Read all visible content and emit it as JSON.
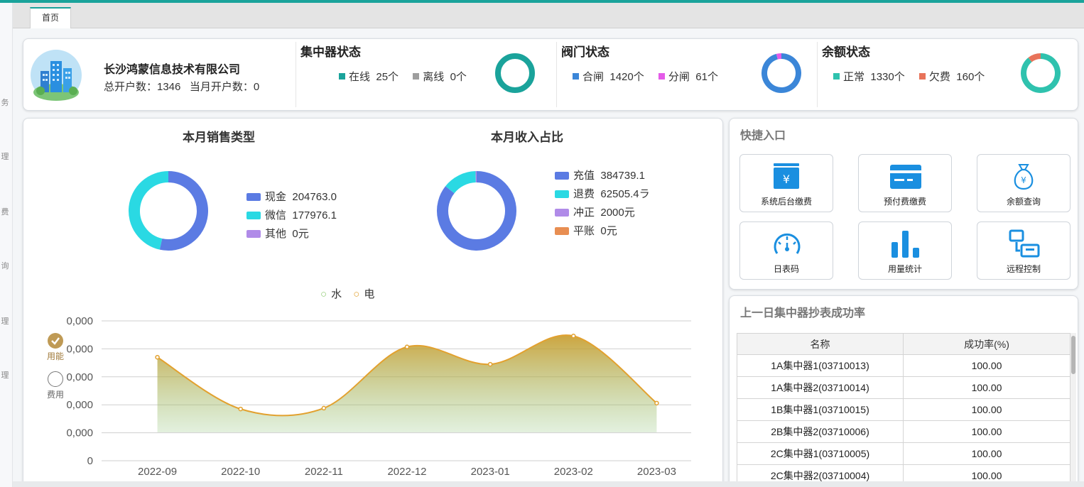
{
  "tabs": [
    {
      "label": "首页"
    }
  ],
  "sidebar_fragments": [
    "务",
    "理",
    "费",
    "询",
    "理",
    "理"
  ],
  "company": {
    "name": "长沙鸿蒙信息技术有限公司",
    "counts_text": "总开户数：1346   当月开户数：0"
  },
  "concentrator": {
    "title": "集中器状态",
    "items": [
      {
        "label": "在线",
        "value": "25个",
        "color": "#1aa39b",
        "count": 25
      },
      {
        "label": "离线",
        "value": "0个",
        "color": "#9e9e9e",
        "count": 0
      }
    ]
  },
  "valve": {
    "title": "阀门状态",
    "items": [
      {
        "label": "合闸",
        "value": "1420个",
        "color": "#3b86d8",
        "count": 1420
      },
      {
        "label": "分闸",
        "value": "61个",
        "color": "#e45be8",
        "count": 61
      }
    ]
  },
  "balance": {
    "title": "余额状态",
    "items": [
      {
        "label": "正常",
        "value": "1330个",
        "color": "#2fc2ae",
        "count": 1330
      },
      {
        "label": "欠费",
        "value": "160个",
        "color": "#e8735a",
        "count": 160
      }
    ]
  },
  "sales_pie": {
    "title": "本月销售类型",
    "items": [
      {
        "label": "现金",
        "value": "204763.0",
        "color": "#5b7be3",
        "amount": 204763.0
      },
      {
        "label": "微信",
        "value": "177976.1",
        "color": "#2ad9e3",
        "amount": 177976.1
      },
      {
        "label": "其他",
        "value": "0元",
        "color": "#b08be8",
        "amount": 0
      }
    ]
  },
  "income_pie": {
    "title": "本月收入占比",
    "items": [
      {
        "label": "充值",
        "value": "384739.1",
        "color": "#5b7be3",
        "amount": 384739.1
      },
      {
        "label": "退费",
        "value": "62505.4ラ",
        "color": "#2ad9e3",
        "amount": 62505.4
      },
      {
        "label": "冲正",
        "value": "2000元",
        "color": "#b08be8",
        "amount": 2000
      },
      {
        "label": "平账",
        "value": "0元",
        "color": "#e88e52",
        "amount": 0
      }
    ]
  },
  "line_legend": [
    {
      "label": "水",
      "color": "#91cc75"
    },
    {
      "label": "电",
      "color": "#e2a12f"
    }
  ],
  "toggles": [
    {
      "label": "用能",
      "checked": true
    },
    {
      "label": "费用",
      "checked": false
    }
  ],
  "chart_data": {
    "type": "area",
    "x": [
      "2022-09",
      "2022-10",
      "2022-11",
      "2022-12",
      "2023-01",
      "2023-02",
      "2023-03"
    ],
    "y_tick_labels": [
      ",0,000",
      ",0,000",
      ",0,000",
      ",0,000",
      ",0,000",
      "0"
    ],
    "series": [
      {
        "name": "电",
        "values": [
          3700,
          1850,
          1880,
          4070,
          3450,
          4460,
          2060
        ],
        "color": "#e2a12f"
      }
    ],
    "ylim": [
      0,
      5000
    ],
    "grid": true,
    "legend": "top-center"
  },
  "quick_entry": {
    "title": "快捷入口",
    "items": [
      {
        "label": "系统后台缴费",
        "icon": "cash-box-icon"
      },
      {
        "label": "预付费缴费",
        "icon": "card-icon"
      },
      {
        "label": "余额查询",
        "icon": "money-bag-icon"
      },
      {
        "label": "日表码",
        "icon": "gauge-icon"
      },
      {
        "label": "用量统计",
        "icon": "bar-chart-icon"
      },
      {
        "label": "远程控制",
        "icon": "remote-control-icon"
      }
    ]
  },
  "success_rate": {
    "title": "上一日集中器抄表成功率",
    "columns": [
      "名称",
      "成功率(%)"
    ],
    "rows": [
      [
        "1A集中器1(03710013)",
        "100.00"
      ],
      [
        "1A集中器2(03710014)",
        "100.00"
      ],
      [
        "1B集中器1(03710015)",
        "100.00"
      ],
      [
        "2B集中器2(03710006)",
        "100.00"
      ],
      [
        "2C集中器1(03710005)",
        "100.00"
      ],
      [
        "2C集中器2(03710004)",
        "100.00"
      ]
    ]
  }
}
